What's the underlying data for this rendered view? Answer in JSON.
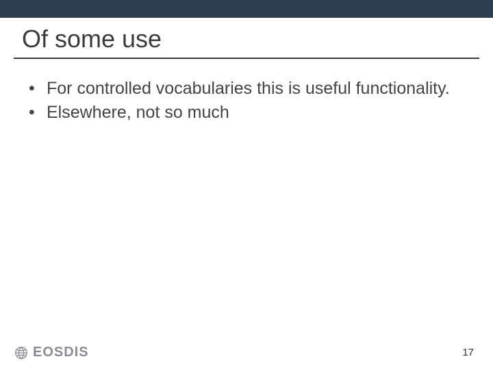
{
  "slide": {
    "title": "Of some use",
    "bullets": [
      "For controlled vocabularies this is useful functionality.",
      "Elsewhere, not so much"
    ]
  },
  "footer": {
    "logo_text": "EOSDIS",
    "page_number": "17"
  },
  "colors": {
    "topbar": "#2e3e50",
    "text": "#3b3b3b"
  }
}
